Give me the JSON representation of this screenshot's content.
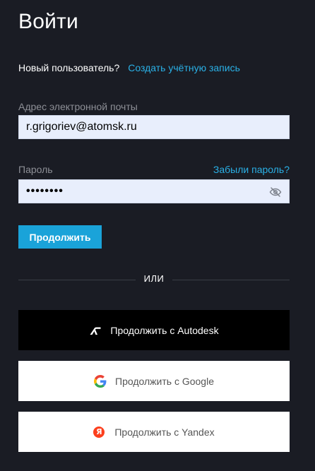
{
  "page": {
    "title": "Войти"
  },
  "new_user": {
    "prompt": "Новый пользователь?",
    "create_link": "Создать учётную запись"
  },
  "email": {
    "label": "Адрес электронной почты",
    "value": "r.grigoriev@atomsk.ru"
  },
  "password": {
    "label": "Пароль",
    "forgot_link": "Забыли пароль?",
    "masked_value": "••••••••"
  },
  "continue_button": {
    "label": "Продолжить"
  },
  "divider": {
    "text": "ИЛИ"
  },
  "sso": {
    "autodesk_label": "Продолжить с Autodesk",
    "google_label": "Продолжить с Google",
    "yandex_label": "Продолжить с Yandex",
    "yandex_glyph": "Я"
  },
  "colors": {
    "background": "#1a1c24",
    "accent": "#1aa3d9",
    "link": "#2ab0e6",
    "input_bg": "#e8eefc"
  }
}
